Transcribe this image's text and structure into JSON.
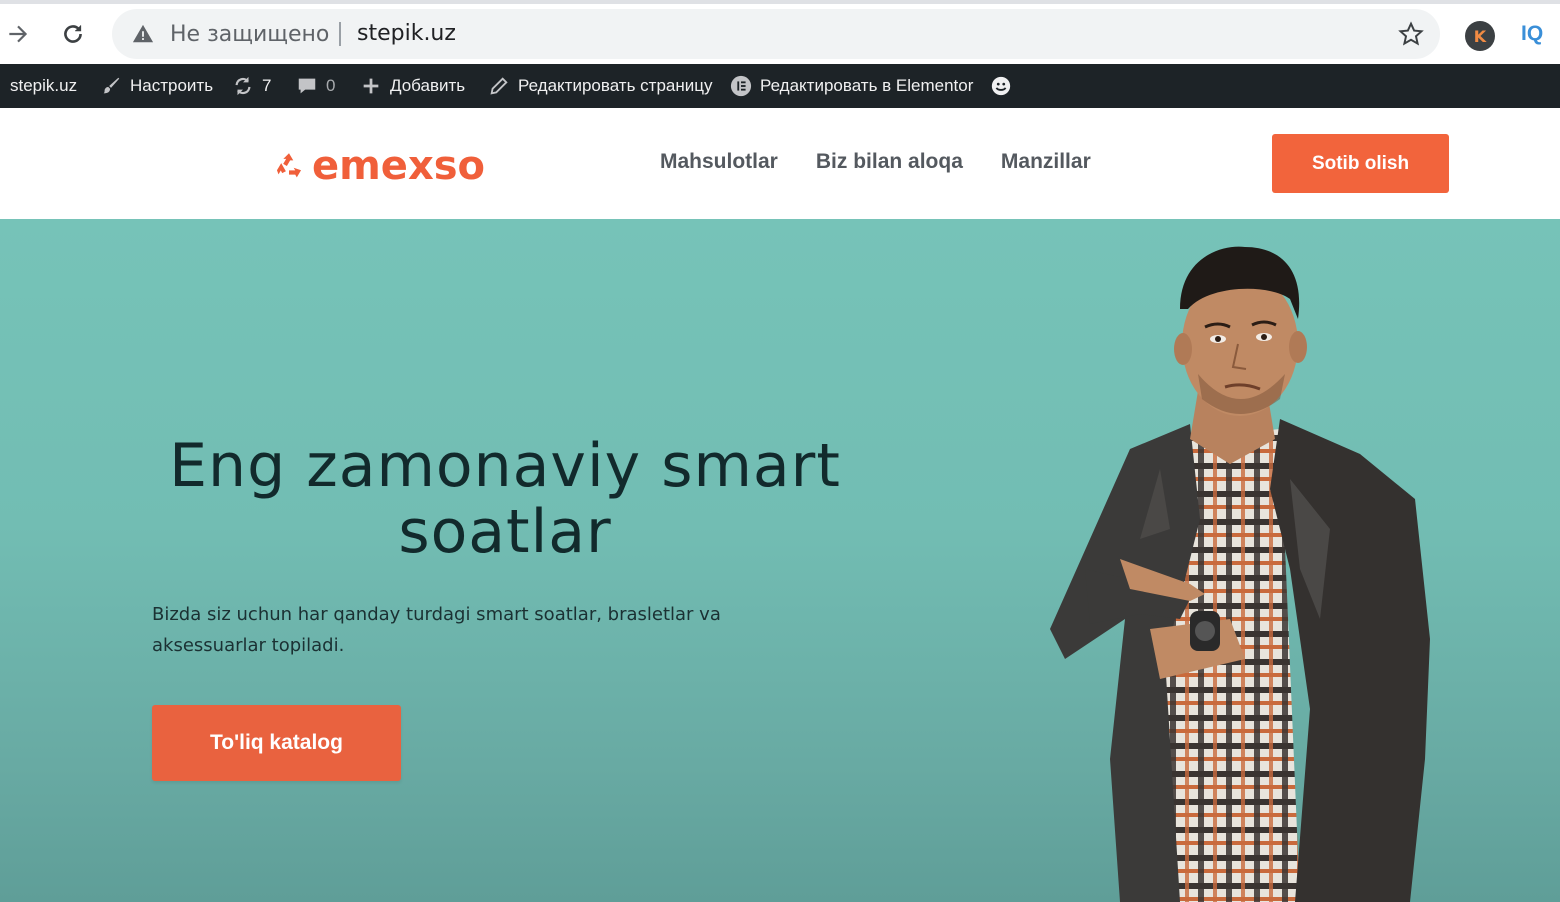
{
  "browser": {
    "security_label": "Не защищено",
    "url": "stepik.uz",
    "profile_initial": "K",
    "extension_label": "IQ"
  },
  "admin_bar": {
    "site_name": "stepik.uz",
    "customize": "Настроить",
    "updates_count": "7",
    "comments_count": "0",
    "add_new": "Добавить",
    "edit_page": "Редактировать страницу",
    "edit_elementor": "Редактировать в Elementor"
  },
  "header": {
    "logo_text": "emexso",
    "nav": [
      "Mahsulotlar",
      "Biz bilan aloqa",
      "Manzillar"
    ],
    "cta_label": "Sotib olish"
  },
  "hero": {
    "title": "Eng zamonaviy smart soatlar",
    "description": "Bizda siz uchun har qanday turdagi smart soatlar, brasletlar va aksessuarlar topiladi.",
    "button_label": "To'liq katalog"
  },
  "colors": {
    "brand_orange": "#f05f3a",
    "hero_bg": "#76c3b8",
    "admin_bar_bg": "#1d2327",
    "title_color": "#122a2c"
  }
}
